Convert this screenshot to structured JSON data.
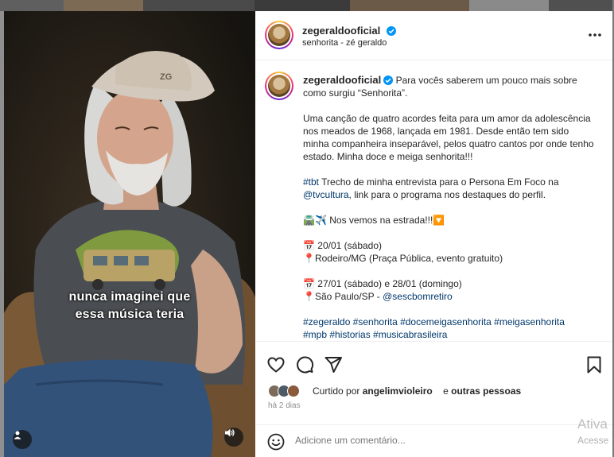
{
  "header": {
    "username": "zegeraldooficial",
    "subtitle": "senhorita - zé geraldo",
    "verified": true
  },
  "media": {
    "caption_line1": "nunca imaginei que",
    "caption_line2": "essa música teria"
  },
  "post": {
    "username": "zegeraldooficial",
    "intro": "Para vocês saberem um pouco mais sobre como surgiu “Senhorita”.",
    "paragraph1": "Uma canção de quatro acordes feita para um amor da adolescência nos meados de 1968, lançada em 1981. Desde então tem sido minha companheira inseparável, pelos quatro cantos por onde tenho estado. Minha doce e meiga senhorita!!!",
    "tbt_tag": "#tbt",
    "tbt_text_a": "Trecho de minha entrevista para o Persona Em Foco na",
    "tbt_mention": "@tvcultura",
    "tbt_text_b": ", link para o programa nos destaques do perfil.",
    "travel_icons": "🛣️✈️",
    "travel_text": "Nos vemos na estrada!!!",
    "travel_arrow": "🔽",
    "event1_date": "20/01 (sábado)",
    "event1_place": "Rodeiro/MG (Praça Pública, evento gratuito)",
    "event2_date": "27/01 (sábado) e 28/01 (domingo)",
    "event2_place_a": "São Paulo/SP - ",
    "event2_mention": "@sescbomretiro",
    "calendar_icon": "📅",
    "pin_icon": "📍",
    "hashtags_line1": "#zegeraldo #senhorita #docemeigasenhorita #meigasenhorita",
    "hashtags_line2": "#mpb #historias #musicabrasileira"
  },
  "actions": {
    "icons": [
      "heart-icon",
      "comment-icon",
      "share-icon",
      "bookmark-icon"
    ],
    "liked_prefix": "Curtido por",
    "liked_user": "angelimvioleiro",
    "liked_and": "e",
    "liked_others": "outras pessoas",
    "time": "há 2 dias"
  },
  "comment": {
    "placeholder": "Adicione um comentário..."
  },
  "watermark": {
    "line1": "Ativa",
    "line2": "Acesse"
  },
  "colors": {
    "link": "#00376b",
    "verified": "#0095f6",
    "text": "#262626",
    "muted": "#8e8e8e"
  }
}
